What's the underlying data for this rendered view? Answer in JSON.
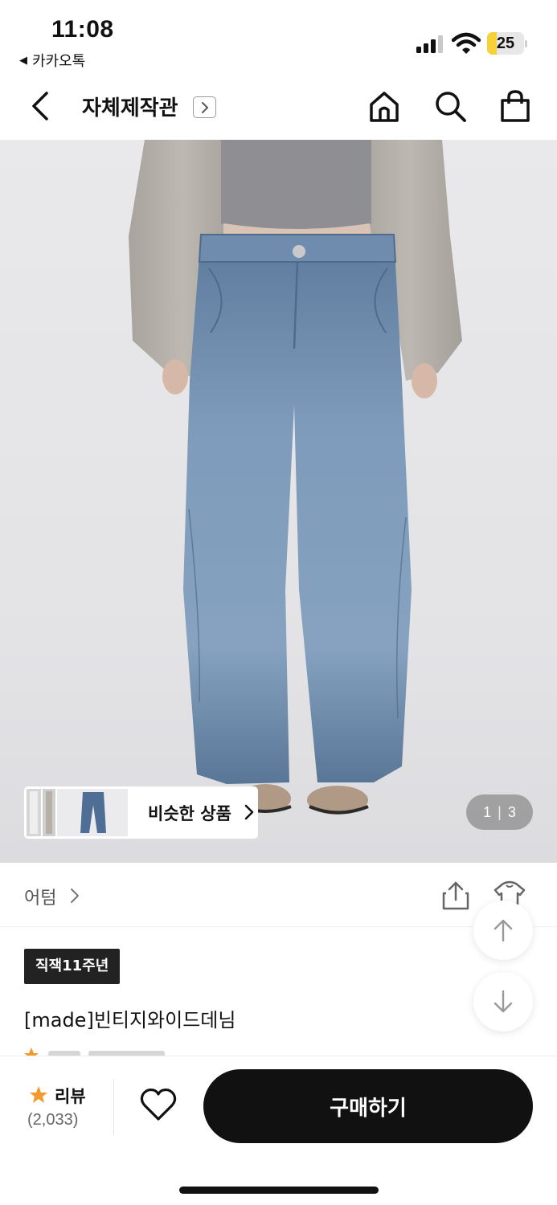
{
  "status_bar": {
    "time": "11:08",
    "back_app": "카카오톡",
    "battery_percent": "25",
    "battery_level": 0.25
  },
  "header": {
    "title": "자체제작관"
  },
  "hero": {
    "similar_label": "비슷한 상품",
    "pager_current": "1",
    "pager_total": "3"
  },
  "brand": {
    "name": "어텀"
  },
  "product": {
    "badge": "직잭11주년",
    "name": "[made]빈티지와이드데님"
  },
  "bottom_bar": {
    "review_label": "리뷰",
    "review_count": "(2,033)",
    "buy_label": "구매하기"
  },
  "colors": {
    "primary_dark": "#111111",
    "review_star": "#f29a2e",
    "battery_fill": "#f7d13a"
  }
}
